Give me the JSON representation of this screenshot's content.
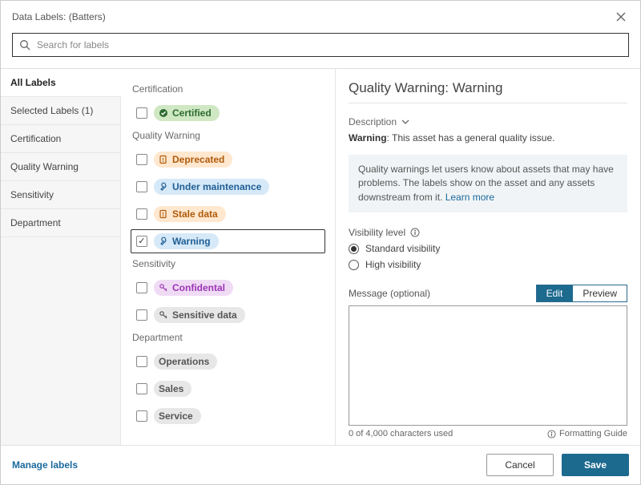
{
  "header": {
    "title": "Data Labels: (Batters)"
  },
  "search": {
    "placeholder": "Search for labels"
  },
  "sidebar": {
    "items": [
      {
        "label": "All Labels"
      },
      {
        "label": "Selected Labels (1)"
      },
      {
        "label": "Certification"
      },
      {
        "label": "Quality Warning"
      },
      {
        "label": "Sensitivity"
      },
      {
        "label": "Department"
      }
    ]
  },
  "labels": {
    "groups": [
      {
        "title": "Certification",
        "items": [
          {
            "text": "Certified",
            "pill": "green",
            "icon": "check-badge-icon",
            "checked": false
          }
        ]
      },
      {
        "title": "Quality Warning",
        "items": [
          {
            "text": "Deprecated",
            "pill": "orange",
            "icon": "warn-doc-icon",
            "checked": false
          },
          {
            "text": "Under maintenance",
            "pill": "blue",
            "icon": "wrench-icon",
            "checked": false
          },
          {
            "text": "Stale data",
            "pill": "orange",
            "icon": "warn-doc-icon",
            "checked": false
          },
          {
            "text": "Warning",
            "pill": "blue",
            "icon": "wrench-icon",
            "checked": true,
            "selected": true
          }
        ]
      },
      {
        "title": "Sensitivity",
        "items": [
          {
            "text": "Confidental",
            "pill": "purple",
            "icon": "key-icon",
            "checked": false
          },
          {
            "text": "Sensitive data",
            "pill": "gray",
            "icon": "key-icon",
            "checked": false
          }
        ]
      },
      {
        "title": "Department",
        "items": [
          {
            "text": "Operations",
            "pill": "gray",
            "icon": "none",
            "checked": false
          },
          {
            "text": "Sales",
            "pill": "gray",
            "icon": "none",
            "checked": false
          },
          {
            "text": "Service",
            "pill": "gray",
            "icon": "none",
            "checked": false
          }
        ]
      }
    ]
  },
  "detail": {
    "title": "Quality Warning: Warning",
    "desc_label": "Description",
    "desc_strong": "Warning",
    "desc_rest": ": This asset has a general quality issue.",
    "info_text": "Quality warnings let users know about assets that may have problems. The labels show on the asset and any assets downstream from it. ",
    "learn_more": "Learn more",
    "visibility_label": "Visibility level",
    "vis_opts": [
      {
        "label": "Standard visibility",
        "selected": true
      },
      {
        "label": "High visibility",
        "selected": false
      }
    ],
    "message_label": "Message (optional)",
    "tab_edit": "Edit",
    "tab_preview": "Preview",
    "char_count": "0 of 4,000 characters used",
    "formatting_guide": "Formatting Guide"
  },
  "footer": {
    "manage": "Manage labels",
    "cancel": "Cancel",
    "save": "Save"
  }
}
